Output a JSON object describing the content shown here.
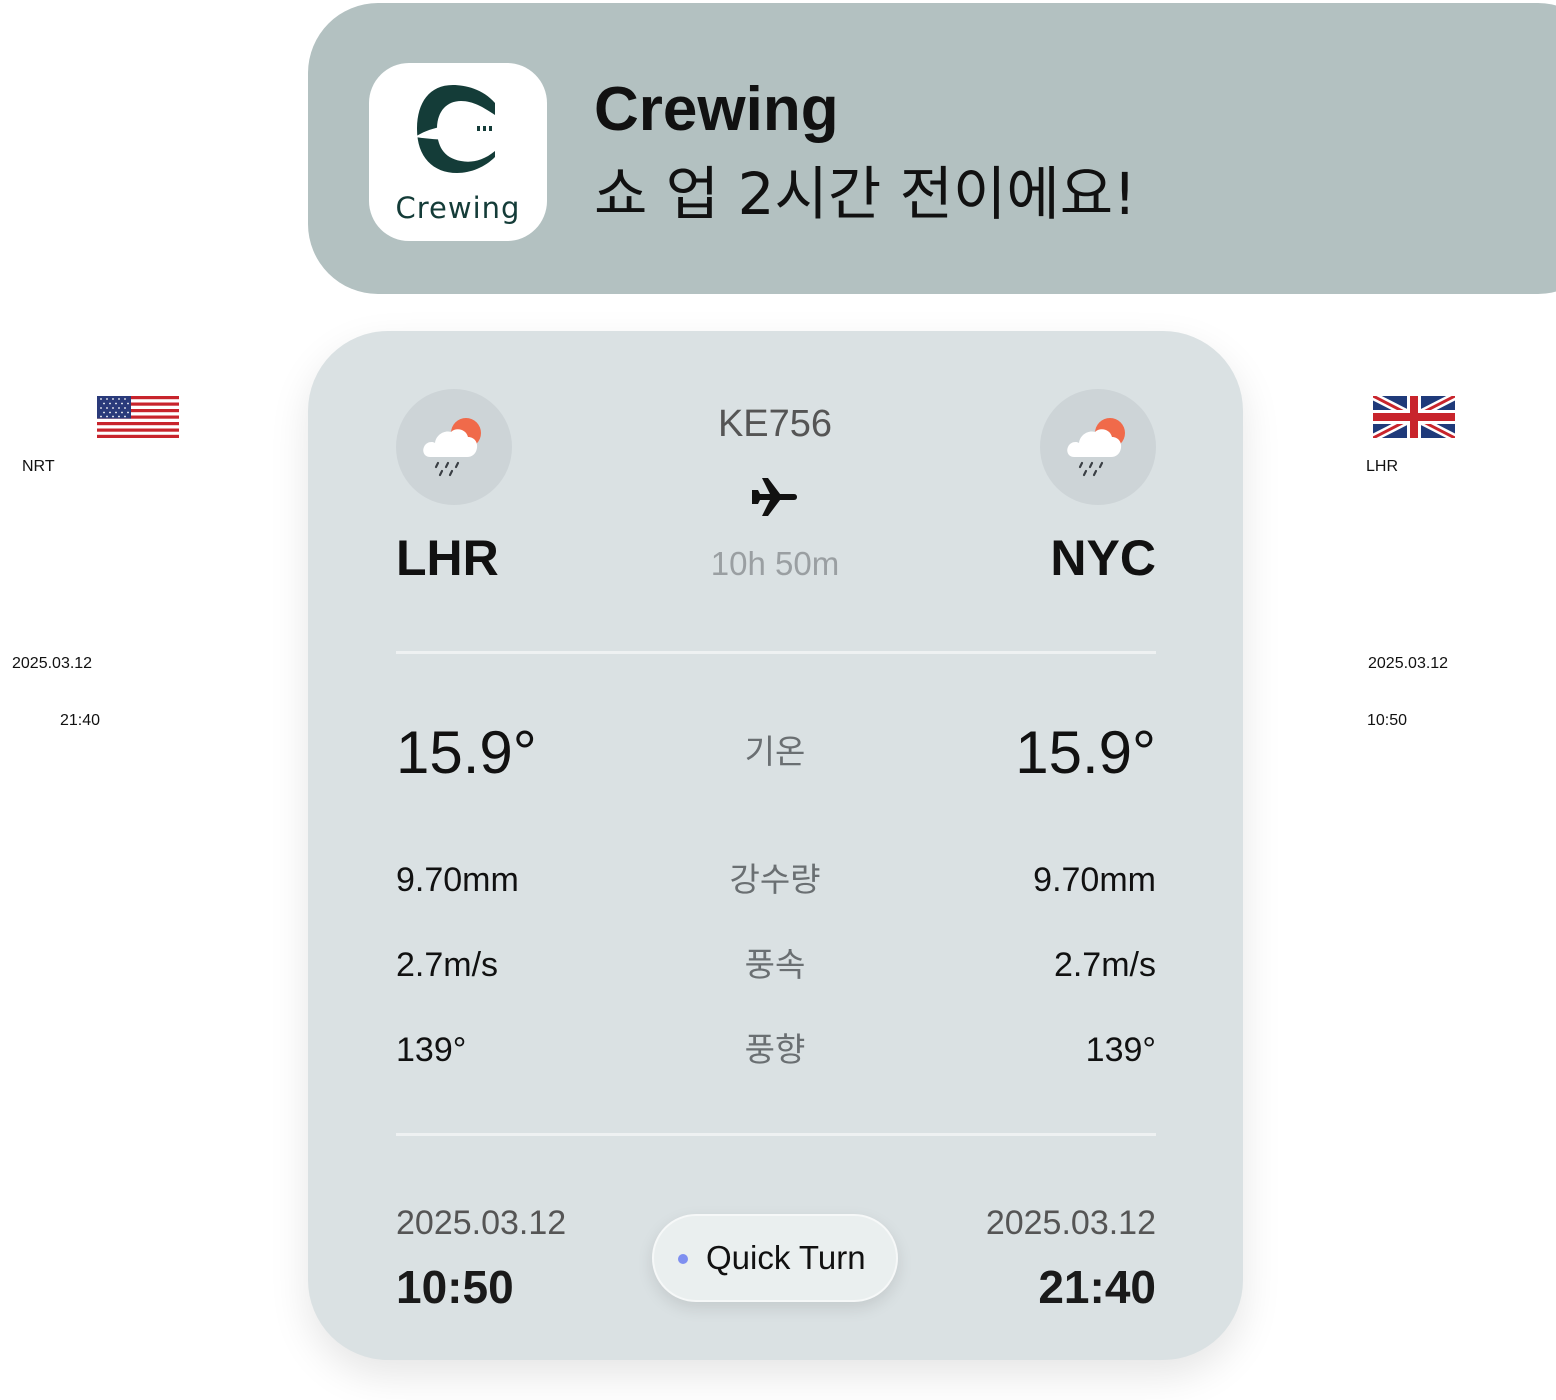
{
  "notification": {
    "app_name": "Crewing",
    "app_icon_label": "Crewing",
    "title": "Crewing",
    "message": "쇼 업 2시간 전이에요!"
  },
  "left_side": {
    "flag": "us-flag-icon",
    "code": "NRT",
    "date": "2025.03.12",
    "time": "21:40"
  },
  "right_side": {
    "flag": "uk-flag-icon",
    "code": "LHR",
    "date": "2025.03.12",
    "time": "10:50"
  },
  "card": {
    "flight_number": "KE756",
    "duration": "10h 50m",
    "origin": {
      "code": "LHR",
      "weather_icon": "rain-cloud-sun-icon",
      "temperature": "15.9°",
      "precipitation": "9.70mm",
      "wind_speed": "2.7m/s",
      "wind_direction": "139°",
      "date": "2025.03.12",
      "time": "10:50"
    },
    "destination": {
      "code": "NYC",
      "weather_icon": "rain-cloud-sun-icon",
      "temperature": "15.9°",
      "precipitation": "9.70mm",
      "wind_speed": "2.7m/s",
      "wind_direction": "139°",
      "date": "2025.03.12",
      "time": "21:40"
    },
    "labels": {
      "temperature": "기온",
      "precipitation": "강수량",
      "wind_speed": "풍속",
      "wind_direction": "풍향"
    },
    "badge": {
      "label": "Quick Turn",
      "dot_color": "#7e8ff0"
    }
  },
  "colors": {
    "banner_bg": "#b3c1c1",
    "card_bg": "#dae1e3",
    "brand": "#143c38",
    "sun": "#f06a4a"
  }
}
